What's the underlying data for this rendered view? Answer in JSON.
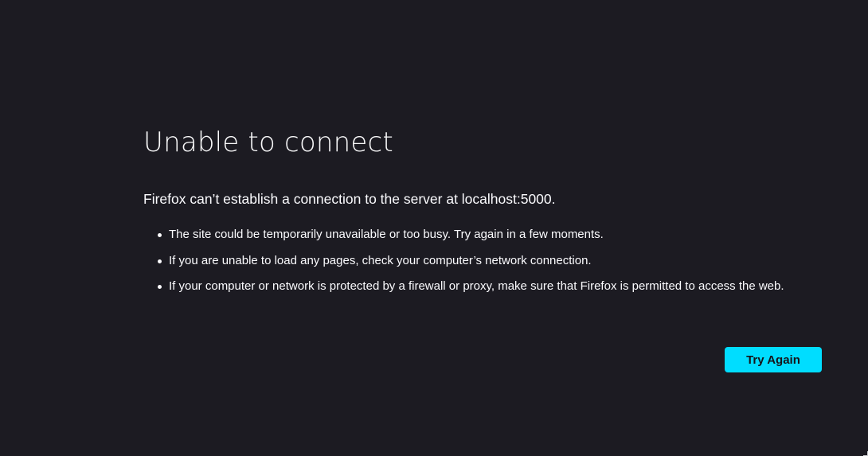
{
  "error_page": {
    "title": "Unable to connect",
    "short_description": "Firefox can’t establish a connection to the server at localhost:5000.",
    "suggestions": [
      "The site could be temporarily unavailable or too busy. Try again in a few moments.",
      "If you are unable to load any pages, check your computer’s network connection.",
      "If your computer or network is protected by a firewall or proxy, make sure that Firefox is permitted to access the web."
    ],
    "try_again_label": "Try Again"
  },
  "colors": {
    "background": "#1c1b22",
    "text": "#fbfbfe",
    "primary_button": "#00ddff",
    "primary_button_text": "#15141a"
  }
}
